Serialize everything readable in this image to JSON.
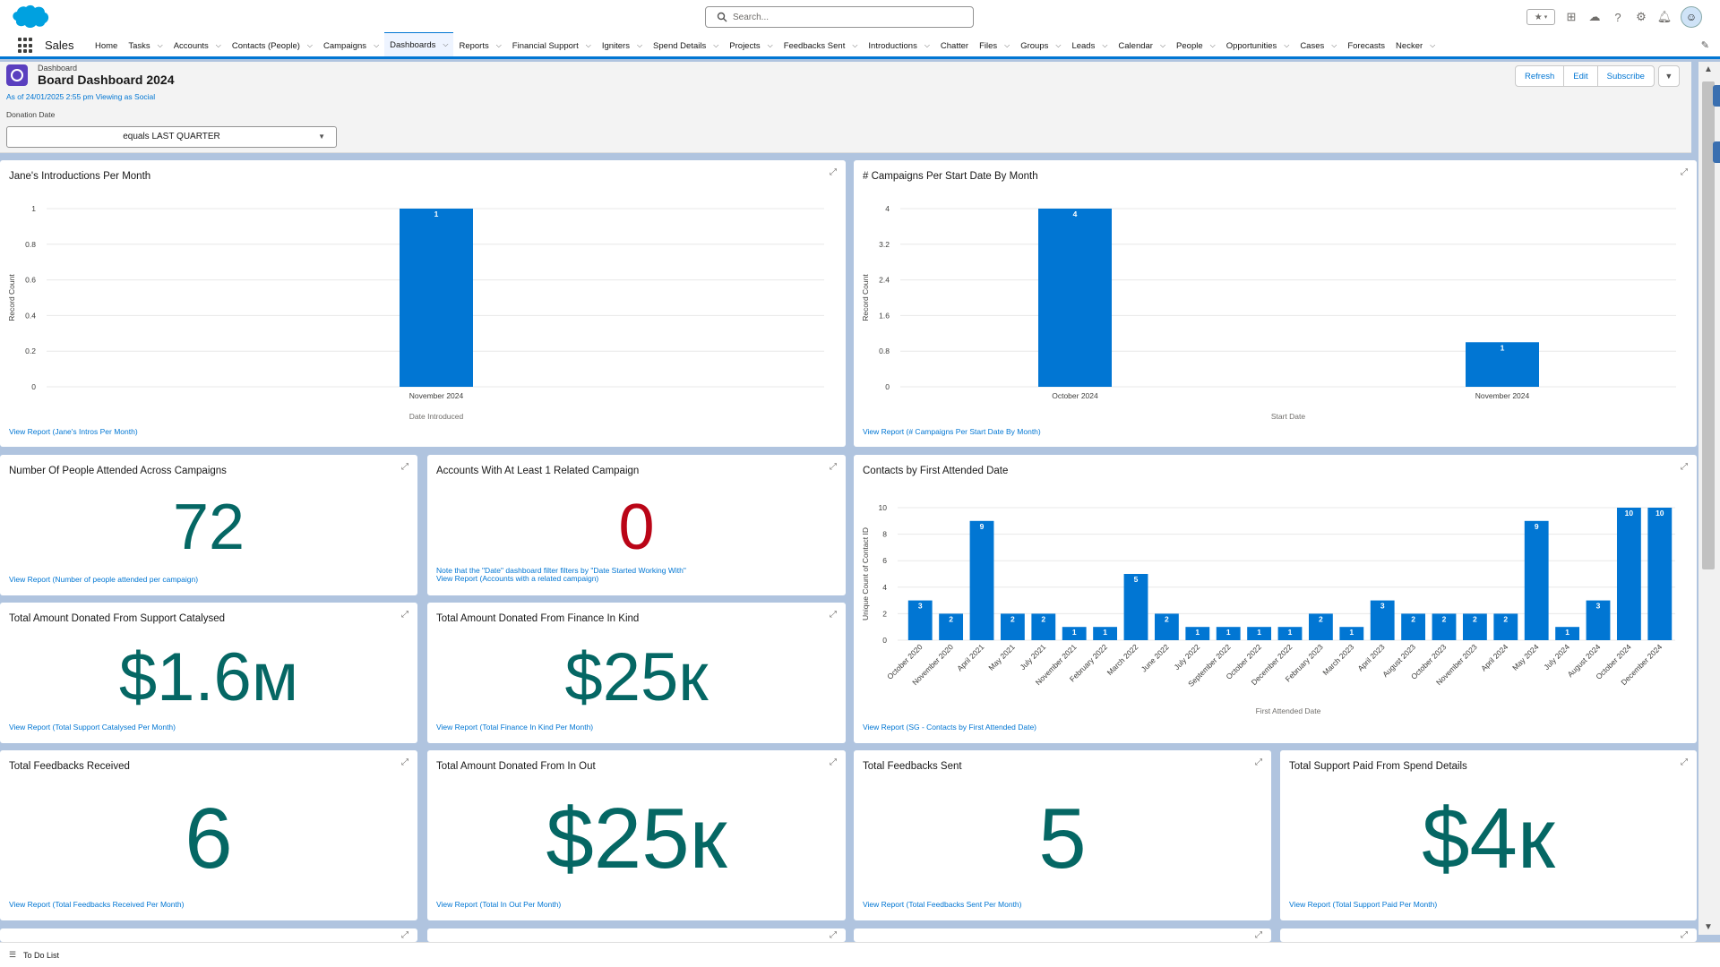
{
  "header": {
    "search_placeholder": "Search...",
    "icons": [
      "favorites-star-icon",
      "add-icon",
      "trailhead-icon",
      "help-icon",
      "settings-icon",
      "notifications-icon",
      "avatar"
    ]
  },
  "nav": {
    "app_name": "Sales",
    "items": [
      {
        "label": "Home",
        "chevron": false
      },
      {
        "label": "Tasks",
        "chevron": true
      },
      {
        "label": "Accounts",
        "chevron": true
      },
      {
        "label": "Contacts (People)",
        "chevron": true
      },
      {
        "label": "Campaigns",
        "chevron": true
      },
      {
        "label": "Dashboards",
        "chevron": true,
        "active": true
      },
      {
        "label": "Reports",
        "chevron": true
      },
      {
        "label": "Financial Support",
        "chevron": true
      },
      {
        "label": "Igniters",
        "chevron": true
      },
      {
        "label": "Spend Details",
        "chevron": true
      },
      {
        "label": "Projects",
        "chevron": true
      },
      {
        "label": "Feedbacks Sent",
        "chevron": true
      },
      {
        "label": "Introductions",
        "chevron": true
      },
      {
        "label": "Chatter",
        "chevron": false
      },
      {
        "label": "Files",
        "chevron": true
      },
      {
        "label": "Groups",
        "chevron": true
      },
      {
        "label": "Leads",
        "chevron": true
      },
      {
        "label": "Calendar",
        "chevron": true
      },
      {
        "label": "People",
        "chevron": true
      },
      {
        "label": "Opportunities",
        "chevron": true
      },
      {
        "label": "Cases",
        "chevron": true
      },
      {
        "label": "Forecasts",
        "chevron": false
      },
      {
        "label": "Necker",
        "chevron": true
      }
    ]
  },
  "dashboard": {
    "type_label": "Dashboard",
    "title": "Board Dashboard 2024",
    "as_of": "As of 24/01/2025 2:55 pm Viewing as Social",
    "filter_label": "Donation Date",
    "filter_value": "equals LAST QUARTER",
    "buttons": {
      "refresh": "Refresh",
      "edit": "Edit",
      "subscribe": "Subscribe"
    }
  },
  "widgets": {
    "intros": {
      "title": "Jane's Introductions Per Month",
      "link": "View Report (Jane's Intros Per Month)"
    },
    "campaigns": {
      "title": "# Campaigns Per Start Date By Month",
      "link": "View Report (# Campaigns Per Start Date By Month)"
    },
    "people_attended": {
      "title": "Number Of People Attended Across Campaigns",
      "value": "72",
      "link": "View Report (Number of people attended per campaign)"
    },
    "accounts_campaign": {
      "title": "Accounts With At Least 1 Related Campaign",
      "value": "0",
      "note": "Note that the \"Date\" dashboard filter filters by \"Date Started Working With\"",
      "link": "View Report (Accounts with a related campaign)"
    },
    "contacts_first": {
      "title": "Contacts by First Attended Date",
      "link": "View Report (SG - Contacts by First Attended Date)"
    },
    "support_catalysed": {
      "title": "Total Amount Donated From Support Catalysed",
      "value": "$1.6м",
      "link": "View Report (Total Support Catalysed Per Month)"
    },
    "finance_in_kind": {
      "title": "Total Amount Donated From Finance In Kind",
      "value": "$25к",
      "link": "View Report (Total Finance In Kind Per Month)"
    },
    "feedbacks_received": {
      "title": "Total Feedbacks Received",
      "value": "6",
      "link": "View Report (Total Feedbacks Received Per Month)"
    },
    "in_out": {
      "title": "Total Amount Donated From In Out",
      "value": "$25к",
      "link": "View Report (Total In Out Per Month)"
    },
    "feedbacks_sent": {
      "title": "Total Feedbacks Sent",
      "value": "5",
      "link": "View Report (Total Feedbacks Sent Per Month)"
    },
    "support_paid": {
      "title": "Total Support Paid From Spend Details",
      "value": "$4к",
      "link": "View Report (Total Support Paid Per Month)"
    }
  },
  "utility": {
    "todo": "To Do List"
  },
  "colors": {
    "bar": "#0176d3",
    "metric": "#056764",
    "metric_zero": "#ba0517",
    "link": "#0176d3"
  },
  "chart_data": [
    {
      "id": "intros",
      "type": "bar",
      "categories": [
        "November 2024"
      ],
      "values": [
        1
      ],
      "xlabel": "Date Introduced",
      "ylabel": "Record Count",
      "ylim": [
        0,
        1
      ],
      "yticks": [
        "0",
        "0.2",
        "0.4",
        "0.6",
        "0.8",
        "1"
      ]
    },
    {
      "id": "campaigns",
      "type": "bar",
      "categories": [
        "October 2024",
        "November 2024"
      ],
      "values": [
        4,
        1
      ],
      "xlabel": "Start Date",
      "ylabel": "Record Count",
      "ylim": [
        0,
        4
      ],
      "yticks": [
        "0",
        "0.8",
        "1.6",
        "2.4",
        "3.2",
        "4"
      ]
    },
    {
      "id": "contacts_first",
      "type": "bar",
      "categories": [
        "October 2020",
        "November 2020",
        "April 2021",
        "May 2021",
        "July 2021",
        "November 2021",
        "February 2022",
        "March 2022",
        "June 2022",
        "July 2022",
        "September 2022",
        "October 2022",
        "December 2022",
        "February 2023",
        "March 2023",
        "April 2023",
        "August 2023",
        "October 2023",
        "November 2023",
        "April 2024",
        "May 2024",
        "July 2024",
        "August 2024",
        "October 2024",
        "December 2024"
      ],
      "values": [
        3,
        2,
        9,
        2,
        2,
        1,
        1,
        5,
        2,
        1,
        1,
        1,
        1,
        2,
        1,
        3,
        2,
        2,
        2,
        2,
        9,
        1,
        3,
        10,
        10
      ],
      "xlabel": "First Attended Date",
      "ylabel": "Unique Count of Contact ID",
      "ylim": [
        0,
        10
      ],
      "yticks": [
        "0",
        "2",
        "4",
        "6",
        "8",
        "10"
      ]
    }
  ]
}
